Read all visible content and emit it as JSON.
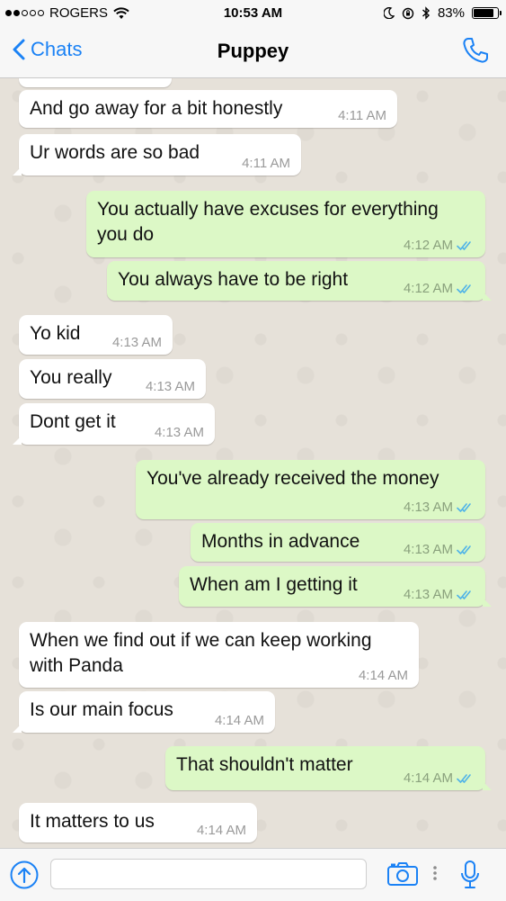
{
  "status_bar": {
    "carrier": "ROGERS",
    "time": "10:53 AM",
    "battery": "83%",
    "battery_level": 0.83,
    "signal_bars": 2,
    "icons": [
      "wifi-icon",
      "moon-icon",
      "rotation-lock-icon",
      "bluetooth-icon",
      "battery-icon"
    ]
  },
  "nav": {
    "back_label": "Chats",
    "title": "Puppey",
    "icons": [
      "chevron-left-icon",
      "phone-icon"
    ]
  },
  "messages": [
    {
      "dir": "in",
      "lines": [
        "And go away for a bit honestly"
      ],
      "time": "4:11 AM"
    },
    {
      "dir": "in",
      "lines": [
        "Ur words are so bad"
      ],
      "time": "4:11 AM"
    },
    {
      "dir": "out",
      "lines": [
        "You actually have excuses for everything",
        "you do"
      ],
      "time": "4:12 AM"
    },
    {
      "dir": "out",
      "lines": [
        "You always have to be right"
      ],
      "time": "4:12 AM"
    },
    {
      "dir": "in",
      "lines": [
        "Yo kid"
      ],
      "time": "4:13 AM"
    },
    {
      "dir": "in",
      "lines": [
        "You really"
      ],
      "time": "4:13 AM"
    },
    {
      "dir": "in",
      "lines": [
        "Dont get it"
      ],
      "time": "4:13 AM"
    },
    {
      "dir": "out",
      "lines": [
        "You've already received the money"
      ],
      "time": "4:13 AM"
    },
    {
      "dir": "out",
      "lines": [
        "Months in advance"
      ],
      "time": "4:13 AM"
    },
    {
      "dir": "out",
      "lines": [
        "When am I getting it"
      ],
      "time": "4:13 AM"
    },
    {
      "dir": "in",
      "lines": [
        "When we find out if we can keep working",
        "with Panda"
      ],
      "time": "4:14 AM"
    },
    {
      "dir": "in",
      "lines": [
        "Is our main focus"
      ],
      "time": "4:14 AM"
    },
    {
      "dir": "out",
      "lines": [
        "That shouldn't matter"
      ],
      "time": "4:14 AM"
    },
    {
      "dir": "in",
      "lines": [
        "It matters to us"
      ],
      "time": "4:14 AM"
    }
  ],
  "input": {
    "value": "",
    "placeholder": "",
    "icons": [
      "upload-arrow-icon",
      "camera-icon",
      "more-dots-icon",
      "microphone-icon"
    ]
  },
  "scroll_button_icon": "chevron-down-circle-icon",
  "colors": {
    "accent": "#1b82f5",
    "outgoing_bubble": "#dcf8c6",
    "incoming_bubble": "#ffffff",
    "read_ticks": "#4fb3e8"
  }
}
